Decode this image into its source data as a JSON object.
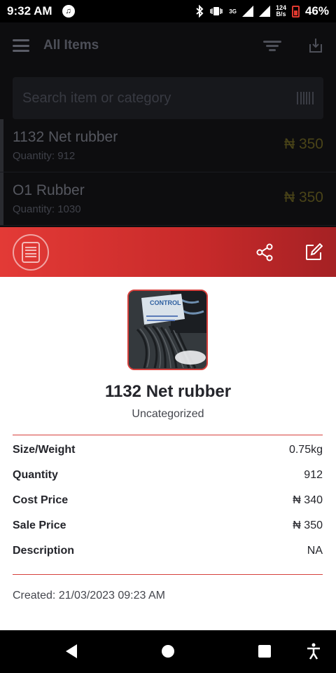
{
  "status_bar": {
    "time": "9:32 AM",
    "network_label": "3G",
    "net_speed_value": "124",
    "net_speed_unit": "B/s",
    "battery": "46%"
  },
  "background_list": {
    "title": "All Items",
    "search_placeholder": "Search item or category",
    "items": [
      {
        "name": "1132 Net rubber",
        "quantity": "Quantity: 912",
        "price": "₦ 350"
      },
      {
        "name": "O1 Rubber",
        "quantity": "Quantity: 1030",
        "price": "₦ 350"
      }
    ]
  },
  "item_detail": {
    "name": "1132 Net rubber",
    "category": "Uncategorized",
    "fields": [
      {
        "label": "Size/Weight",
        "value": "0.75kg"
      },
      {
        "label": "Quantity",
        "value": "912"
      },
      {
        "label": "Cost Price",
        "value": "₦ 340"
      },
      {
        "label": "Sale Price",
        "value": "₦ 350"
      },
      {
        "label": "Description",
        "value": "NA"
      }
    ],
    "created": "Created: 21/03/2023 09:23 AM",
    "image_label": "CONTROL"
  },
  "colors": {
    "accent": "#d6403c",
    "header_gradient_start": "#e33a36",
    "header_gradient_end": "#a52124"
  },
  "icons": {
    "header_logo": "document-list-icon",
    "share": "share-icon",
    "edit": "edit-icon",
    "nav_back": "back-triangle-icon",
    "nav_home": "home-circle-icon",
    "nav_recents": "recents-square-icon",
    "nav_accessibility": "accessibility-icon"
  }
}
